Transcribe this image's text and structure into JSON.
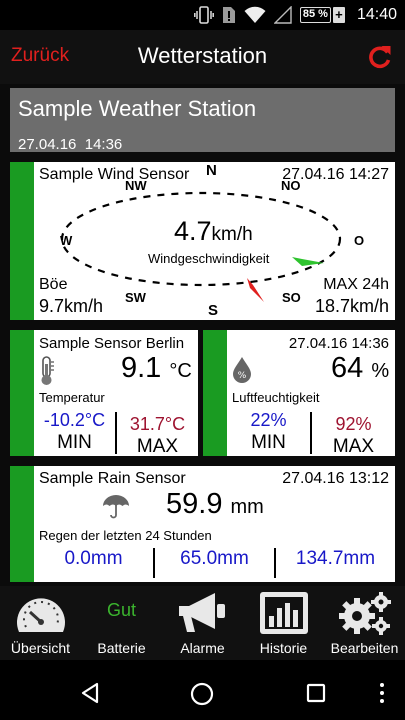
{
  "status_bar": {
    "battery": "85 %",
    "charging_symbol": "+",
    "time": "14:40"
  },
  "header": {
    "back_label": "Zurück",
    "title": "Wetterstation",
    "refresh_icon": "refresh-icon"
  },
  "station": {
    "name": "Sample Weather Station",
    "date": "27.04.16",
    "time": "14:36"
  },
  "wind_sensor": {
    "name": "Sample Wind Sensor",
    "timestamp": "27.04.16  14:27",
    "directions": {
      "n": "N",
      "no": "NO",
      "o": "O",
      "so": "SO",
      "s": "S",
      "sw": "SW",
      "w": "W",
      "nw": "NW"
    },
    "speed_value": "4.7",
    "speed_unit": "km/h",
    "speed_label": "Windgeschwindigkeit",
    "gust_label": "Böe",
    "gust_value": "9.7km/h",
    "max_label": "MAX 24h",
    "max_value": "18.7km/h"
  },
  "temperature_sensor": {
    "name": "Sample Sensor Berlin",
    "value": "9.1",
    "unit": "°C",
    "label": "Temperatur",
    "min_value": "-10.2°C",
    "min_label": "MIN",
    "max_value": "31.7°C",
    "max_label": "MAX"
  },
  "humidity_sensor": {
    "timestamp": "27.04.16  14:36",
    "value": "64",
    "unit": "%",
    "label": "Luftfeuchtigkeit",
    "min_value": "22%",
    "min_label": "MIN",
    "max_value": "92%",
    "max_label": "MAX"
  },
  "rain_sensor": {
    "name": "Sample Rain Sensor",
    "timestamp": "27.04.16  13:12",
    "value": "59.9",
    "unit": "mm",
    "description": "Regen der letzten 24 Stunden",
    "values": [
      "0.0mm",
      "65.0mm",
      "134.7mm"
    ]
  },
  "bottom_nav": {
    "overview": "Übersicht",
    "battery_status": "Gut",
    "battery": "Batterie",
    "alarms": "Alarme",
    "history": "Historie",
    "edit": "Bearbeiten"
  },
  "colors": {
    "accent_red": "#e0201e",
    "sensor_green": "#1a9b22",
    "station_bg": "#6d6d6d",
    "min_blue": "#1818c8",
    "max_red": "#9e1330"
  }
}
